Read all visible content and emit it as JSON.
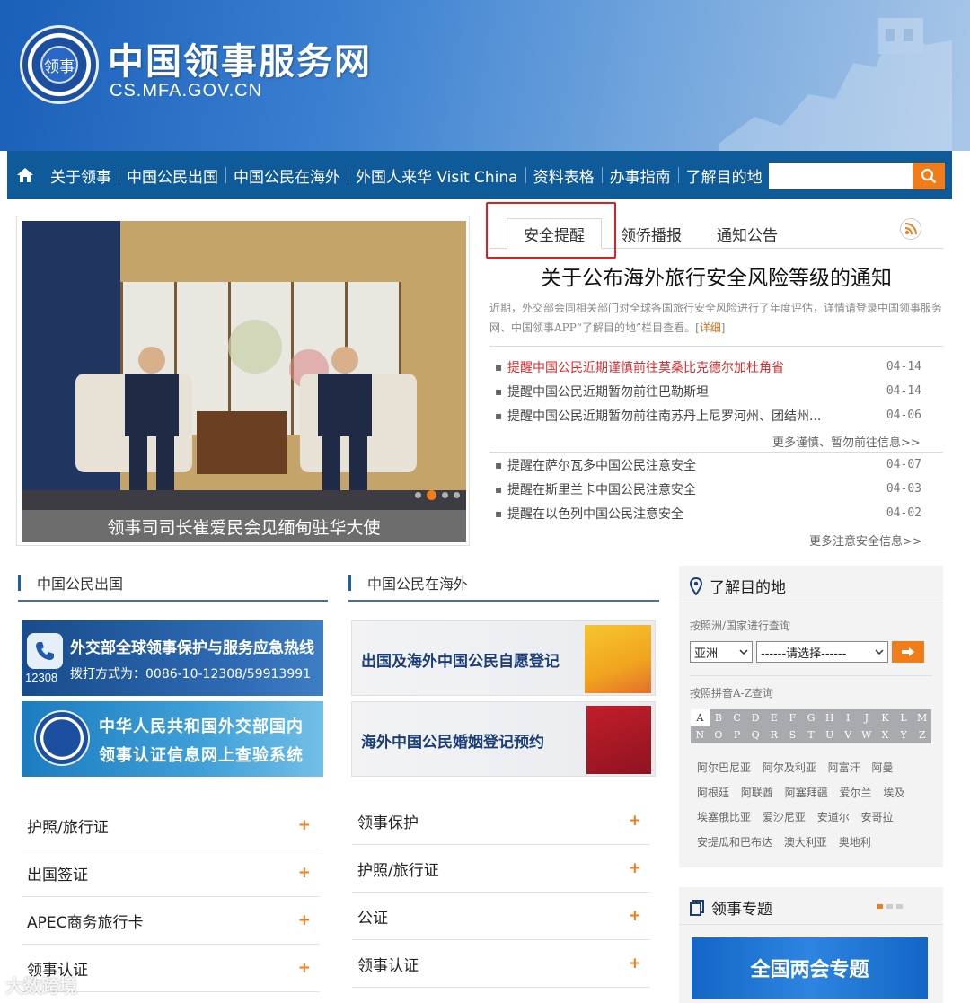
{
  "header": {
    "seal_text": "领事",
    "title": "中国领事服务网",
    "url": "CS.MFA.GOV.CN"
  },
  "nav": {
    "items": [
      "关于领事",
      "中国公民出国",
      "中国公民在海外",
      "外国人来华 Visit China",
      "资料表格",
      "办事指南",
      "了解目的地"
    ],
    "search_placeholder": ""
  },
  "slider": {
    "caption": "领事司司长崔爱民会见缅甸驻华大使"
  },
  "tabs": {
    "items": [
      "安全提醒",
      "领侨播报",
      "通知公告"
    ]
  },
  "notice": {
    "headline": "关于公布海外旅行安全风险等级的通知",
    "summary": "近期，外交部会同相关部门对全球各国旅行安全风险进行了年度评估，详情请登录中国领事服务网、中国领事APP“了解目的地”栏目查看。",
    "detail_link": "详细"
  },
  "warnings": [
    {
      "title": "提醒中国公民近期谨慎前往莫桑比克德尔加杜角省",
      "date": "04-14",
      "red": true
    },
    {
      "title": "提醒中国公民近期暂勿前往巴勒斯坦",
      "date": "04-14",
      "red": false
    },
    {
      "title": "提醒中国公民近期暂勿前往南苏丹上尼罗河州、团结州...",
      "date": "04-06",
      "red": false
    }
  ],
  "warnings_more": "更多谨慎、暂勿前往信息>>",
  "safety": [
    {
      "title": "提醒在萨尔瓦多中国公民注意安全",
      "date": "04-07"
    },
    {
      "title": "提醒在斯里兰卡中国公民注意安全",
      "date": "04-03"
    },
    {
      "title": "提醒在以色列中国公民注意安全",
      "date": "04-02"
    }
  ],
  "safety_more": "更多注意安全信息>>",
  "col_abroad": {
    "title": "中国公民出国",
    "hotline_title": "外交部全球领事保护与服务应急热线",
    "hotline_number": "12308",
    "hotline_dial": "拨打方式为：0086-10-12308/59913991",
    "cert_line1": "中华人民共和国外交部国内",
    "cert_line2": "领事认证信息网上查验系统",
    "links": [
      "护照/旅行证",
      "出国签证",
      "APEC商务旅行卡",
      "领事认证"
    ]
  },
  "col_overseas": {
    "title": "中国公民在海外",
    "reg_banner": "出国及海外中国公民自愿登记",
    "marriage_banner": "海外中国公民婚姻登记预约",
    "links": [
      "领事保护",
      "护照/旅行证",
      "公证",
      "领事认证"
    ]
  },
  "destination": {
    "title": "了解目的地",
    "by_continent_label": "按照洲/国家进行查询",
    "continent_value": "亚洲",
    "country_value": "------请选择------",
    "by_pinyin_label": "按照拼音A-Z查询",
    "letters": [
      "A",
      "B",
      "C",
      "D",
      "E",
      "F",
      "G",
      "H",
      "I",
      "J",
      "K",
      "L",
      "M",
      "N",
      "O",
      "P",
      "Q",
      "R",
      "S",
      "T",
      "U",
      "V",
      "W",
      "X",
      "Y",
      "Z"
    ],
    "countries": [
      "阿尔巴尼亚",
      "阿尔及利亚",
      "阿富汗",
      "阿曼",
      "阿根廷",
      "阿联酋",
      "阿塞拜疆",
      "爱尔兰",
      "埃及",
      "埃塞俄比亚",
      "爱沙尼亚",
      "安道尔",
      "安哥拉",
      "安提瓜和巴布达",
      "澳大利亚",
      "奥地利"
    ]
  },
  "topics": {
    "title": "领事专题",
    "banner": "全国两会专题"
  },
  "watermark": "大数跨境",
  "colors": {
    "nav_bg": "#0f5a99",
    "accent": "#f07c1a",
    "alert_red": "#d92b2b"
  },
  "icons": {
    "home": "home-icon",
    "search": "search-icon",
    "rss": "rss-icon",
    "location": "location-pin-icon",
    "phone": "phone-icon",
    "arrow": "arrow-right-icon",
    "topics": "document-stack-icon"
  }
}
